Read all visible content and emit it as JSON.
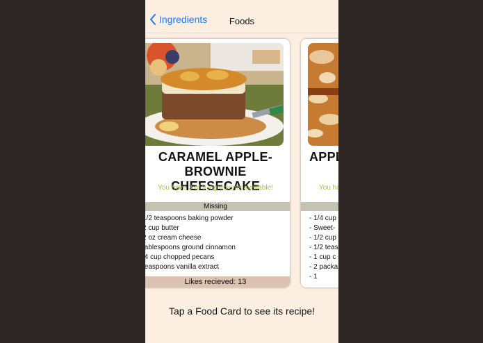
{
  "nav": {
    "back_label": "Ingredients",
    "title": "Foods"
  },
  "cards": [
    {
      "title_line1": "CARAMEL APPLE-",
      "title_line2": "BROWNIE CHEESECAKE",
      "availability": "You have 3 of 9 ingredients available!",
      "missing_label": "Missing",
      "ingredients": [
        "1/2 teaspoons baking powder",
        "2 cup butter",
        "2 oz cream cheese",
        "tablespoons ground cinnamon",
        "/4 cup chopped pecans",
        "teaspoons vanilla extract"
      ],
      "likes": "Likes recieved: 13"
    },
    {
      "title_line1": "APPL",
      "availability": "You ha",
      "missing_label": "",
      "ingredients": [
        "- 1/4 cup",
        "- Sweet-",
        "- 1/2 cup",
        "- 1/2 teas",
        "- 1 cup c",
        "- 2 packa",
        "- 1"
      ]
    }
  ],
  "hint": "Tap a Food Card to see its recipe!"
}
